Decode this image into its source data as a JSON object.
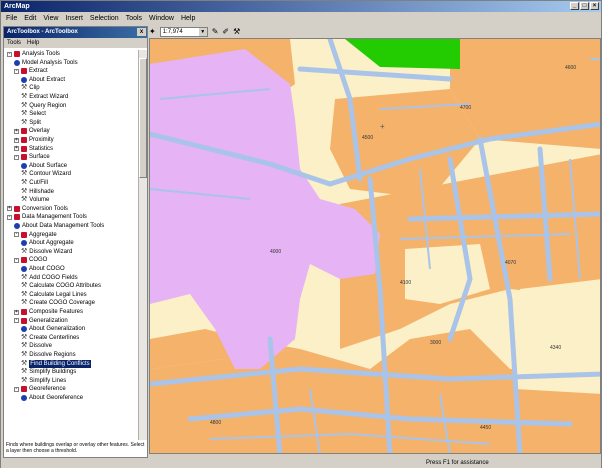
{
  "window": {
    "title": "ArcMap"
  },
  "menubar": [
    "File",
    "Edit",
    "View",
    "Insert",
    "Selection",
    "Tools",
    "Window",
    "Help"
  ],
  "toolbar": {
    "scale": "1:7,974"
  },
  "toolbox": {
    "title": "ArcToolbox - ArcToolbox",
    "close_label": "x",
    "menu": [
      "Tools",
      "Help"
    ],
    "tree": [
      {
        "label": "Analysis Tools",
        "type": "box",
        "indent": 1,
        "exp": "-"
      },
      {
        "label": "Model Analysis Tools",
        "type": "info",
        "indent": 2
      },
      {
        "label": "Extract",
        "type": "box",
        "indent": 2,
        "exp": "-"
      },
      {
        "label": "About Extract",
        "type": "info",
        "indent": 3
      },
      {
        "label": "Clip",
        "type": "tool",
        "indent": 3
      },
      {
        "label": "Extract Wizard",
        "type": "tool",
        "indent": 3
      },
      {
        "label": "Query Region",
        "type": "tool",
        "indent": 3
      },
      {
        "label": "Select",
        "type": "tool",
        "indent": 3
      },
      {
        "label": "Split",
        "type": "tool",
        "indent": 3
      },
      {
        "label": "Overlay",
        "type": "box",
        "indent": 2,
        "exp": "+"
      },
      {
        "label": "Proximity",
        "type": "box",
        "indent": 2,
        "exp": "+"
      },
      {
        "label": "Statistics",
        "type": "box",
        "indent": 2,
        "exp": "+"
      },
      {
        "label": "Surface",
        "type": "box",
        "indent": 2,
        "exp": "-"
      },
      {
        "label": "About Surface",
        "type": "info",
        "indent": 3
      },
      {
        "label": "Contour Wizard",
        "type": "tool",
        "indent": 3
      },
      {
        "label": "Cut/Fill",
        "type": "tool",
        "indent": 3
      },
      {
        "label": "Hillshade",
        "type": "tool",
        "indent": 3
      },
      {
        "label": "Volume",
        "type": "tool",
        "indent": 3
      },
      {
        "label": "Conversion Tools",
        "type": "box",
        "indent": 1,
        "exp": "+"
      },
      {
        "label": "Data Management Tools",
        "type": "box",
        "indent": 1,
        "exp": "-"
      },
      {
        "label": "About Data Management Tools",
        "type": "info",
        "indent": 2
      },
      {
        "label": "Aggregate",
        "type": "box",
        "indent": 2,
        "exp": "-"
      },
      {
        "label": "About Aggregate",
        "type": "info",
        "indent": 3
      },
      {
        "label": "Dissolve Wizard",
        "type": "tool",
        "indent": 3
      },
      {
        "label": "COGO",
        "type": "box",
        "indent": 2,
        "exp": "-"
      },
      {
        "label": "About COGO",
        "type": "info",
        "indent": 3
      },
      {
        "label": "Add COGO Fields",
        "type": "tool",
        "indent": 3
      },
      {
        "label": "Calculate COGO Attributes",
        "type": "tool",
        "indent": 3
      },
      {
        "label": "Calculate Legal Lines",
        "type": "tool",
        "indent": 3
      },
      {
        "label": "Create COGO Coverage",
        "type": "tool",
        "indent": 3
      },
      {
        "label": "Composite Features",
        "type": "box",
        "indent": 2,
        "exp": "+"
      },
      {
        "label": "Generalization",
        "type": "box",
        "indent": 2,
        "exp": "-"
      },
      {
        "label": "About Generalization",
        "type": "info",
        "indent": 3
      },
      {
        "label": "Create Centerlines",
        "type": "tool",
        "indent": 3
      },
      {
        "label": "Dissolve",
        "type": "tool",
        "indent": 3
      },
      {
        "label": "Dissolve Regions",
        "type": "tool",
        "indent": 3
      },
      {
        "label": "Find Building Conflicts",
        "type": "tool",
        "indent": 3,
        "selected": true
      },
      {
        "label": "Simplify Buildings",
        "type": "tool",
        "indent": 3
      },
      {
        "label": "Simplify Lines",
        "type": "tool",
        "indent": 3
      },
      {
        "label": "Georeference",
        "type": "box",
        "indent": 2,
        "exp": "-"
      },
      {
        "label": "About Georeference",
        "type": "info",
        "indent": 3
      }
    ],
    "help_text": "Finds where buildings overlap or overlay other features. Select a layer then choose a threshold."
  },
  "map": {
    "labels": [
      "4500",
      "4070",
      "4000",
      "4100",
      "4340",
      "3000",
      "4600",
      "4700",
      "4800",
      "4450"
    ]
  },
  "status": {
    "text": "Press F1 for assistance"
  },
  "colors": {
    "residential": "#f4b26b",
    "park": "#e6b3f5",
    "green": "#22cc00",
    "roads": "#a9c4e8",
    "open": "#fbf0c8"
  }
}
